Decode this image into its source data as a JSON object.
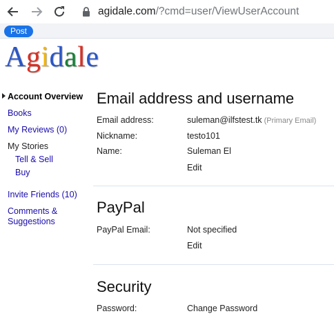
{
  "browser": {
    "url_host": "agidale.com",
    "url_path": "/?cmd=user/ViewUserAccount",
    "post_label": "Post"
  },
  "logo": {
    "letters": [
      {
        "ch": "A",
        "color": "#2a56c6"
      },
      {
        "ch": "g",
        "color": "#d93025"
      },
      {
        "ch": "i",
        "color": "#f4b400"
      },
      {
        "ch": "d",
        "color": "#2a56c6"
      },
      {
        "ch": "a",
        "color": "#188038"
      },
      {
        "ch": "l",
        "color": "#d93025"
      },
      {
        "ch": "e",
        "color": "#2a56c6"
      }
    ]
  },
  "sidebar": {
    "account_overview": "Account Overview",
    "books": "Books",
    "my_reviews": "My Reviews (0)",
    "my_stories": "My Stories",
    "tell_sell": "Tell & Sell",
    "buy": "Buy",
    "invite_friends": "Invite Friends (10)",
    "comments_line1": "Comments &",
    "comments_line2": "Suggestions"
  },
  "email_section": {
    "title": "Email address and username",
    "email_label": "Email address:",
    "email_value": "suleman@ilfstest.tk",
    "email_note": "(Primary Email)",
    "nickname_label": "Nickname:",
    "nickname_value": "testo101",
    "name_label": "Name:",
    "name_value": "Suleman El",
    "edit": "Edit"
  },
  "paypal_section": {
    "title": "PayPal",
    "email_label": "PayPal Email:",
    "email_value": "Not specified",
    "edit": "Edit"
  },
  "security_section": {
    "title": "Security",
    "password_label": "Password:",
    "change_password": "Change Password"
  }
}
